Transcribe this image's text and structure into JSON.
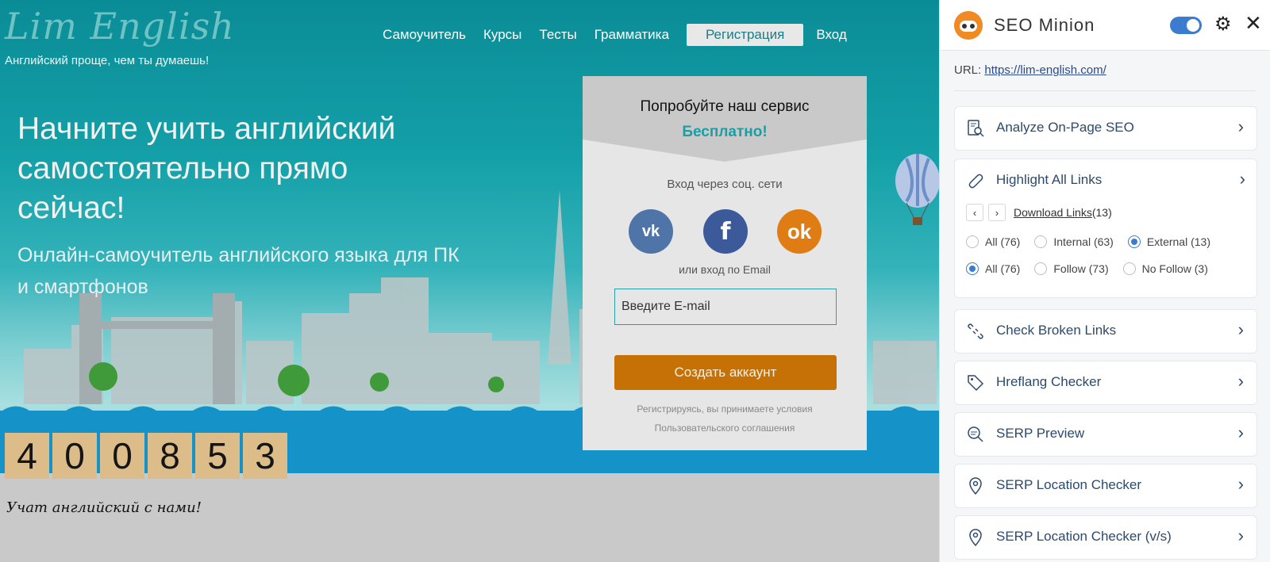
{
  "site": {
    "logo": "Lim English",
    "tagline": "Английский проще, чем ты думаешь!",
    "nav": [
      "Самоучитель",
      "Курсы",
      "Тесты",
      "Грамматика"
    ],
    "register_label": "Регистрация",
    "login_label": "Вход",
    "hero_title": "Начните учить английский самостоятельно прямо сейчас!",
    "hero_subtitle": "Онлайн-самоучитель английского языка для ПК и смартфонов",
    "form": {
      "title": "Попробуйте наш сервис",
      "free": "Бесплатно!",
      "social_label": "Вход через соц. сети",
      "vk": "vk",
      "fb": "f",
      "ok": "ok",
      "email_label": "или вход по Email",
      "email_placeholder": "Введите E-mail",
      "create_button": "Создать аккаунт",
      "terms_line1": "Регистрируясь, вы принимаете условия",
      "terms_line2": "Пользовательского соглашения"
    },
    "counter_digits": [
      "4",
      "0",
      "0",
      "8",
      "5",
      "3"
    ],
    "counter_caption": "Учат английский с нами!"
  },
  "panel": {
    "title": "SEO Minion",
    "toggle_on": true,
    "url_label": "URL:",
    "url": "https://lim-english.com/",
    "analyze": "Analyze On-Page SEO",
    "highlight": "Highlight All Links",
    "download_links": "Download Links",
    "download_count": "(13)",
    "filter1": [
      {
        "label": "All (76)",
        "checked": false
      },
      {
        "label": "Internal (63)",
        "checked": false
      },
      {
        "label": "External (13)",
        "checked": true
      }
    ],
    "filter2": [
      {
        "label": "All (76)",
        "checked": true
      },
      {
        "label": "Follow (73)",
        "checked": false
      },
      {
        "label": "No Follow (3)",
        "checked": false
      }
    ],
    "broken": "Check Broken Links",
    "hreflang": "Hreflang Checker",
    "serp_preview": "SERP Preview",
    "serp_location": "SERP Location Checker",
    "serp_location_vs": "SERP Location Checker (v/s)"
  },
  "colors": {
    "accent": "#3c7ccf",
    "brand_orange": "#c57106",
    "teal": "#14a0a8"
  }
}
